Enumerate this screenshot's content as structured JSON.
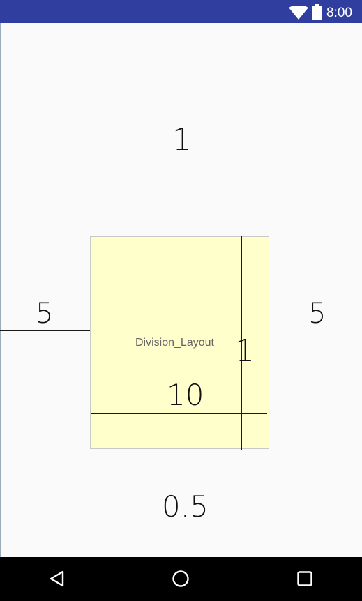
{
  "status_bar": {
    "time": "8:00",
    "icons": [
      "wifi-icon",
      "battery-icon"
    ],
    "color": "#303f9f"
  },
  "layout": {
    "top_weight": "1",
    "left_weight": "5",
    "right_weight": "5",
    "bottom_weight": "0.5",
    "inner_vertical_weight": "1",
    "inner_horizontal_weight": "10",
    "center_title": "Division_Layout",
    "center_color": "#ffffcc"
  },
  "nav_bar": {
    "buttons": [
      "back-icon",
      "home-icon",
      "recents-icon"
    ]
  }
}
